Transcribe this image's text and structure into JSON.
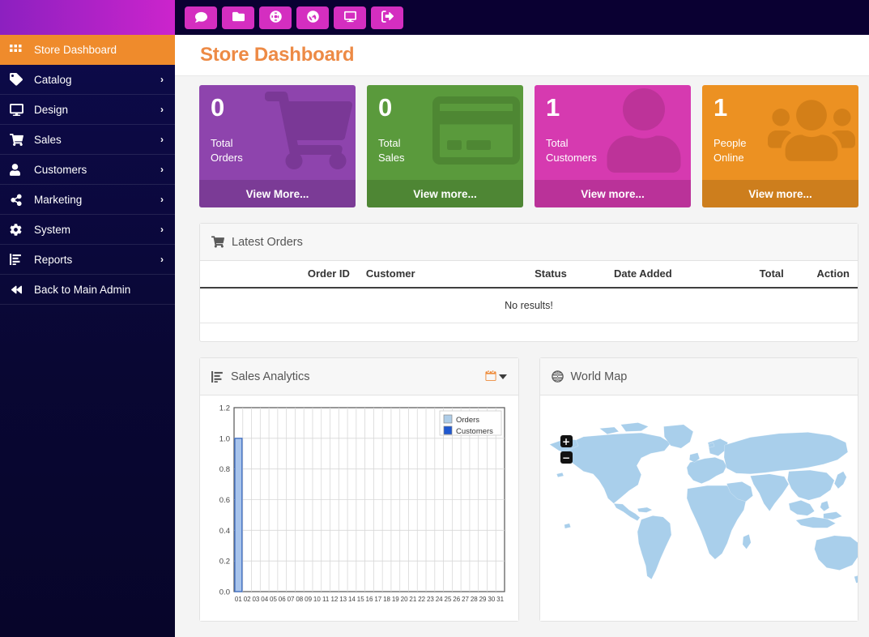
{
  "topbar": {
    "tools": [
      {
        "name": "comment-icon",
        "title": "Comments"
      },
      {
        "name": "folder-icon",
        "title": "Files"
      },
      {
        "name": "life-ring-icon",
        "title": "Support"
      },
      {
        "name": "globe-icon",
        "title": "Store Front"
      },
      {
        "name": "desktop-icon",
        "title": "Preview"
      },
      {
        "name": "sign-out-icon",
        "title": "Logout"
      }
    ],
    "accent_color": "#d42ec0",
    "background_color": "#0a0032",
    "logo_gradient_from": "#8c20c0",
    "logo_gradient_to": "#cc24cc"
  },
  "sidebar": {
    "background_color": "#0d0a4a",
    "active_color": "#ef8b2c",
    "items": [
      {
        "label": "Store Dashboard",
        "icon": "grid-icon",
        "active": true,
        "caret": ""
      },
      {
        "label": "Catalog",
        "icon": "tag-icon",
        "active": false,
        "caret": "›"
      },
      {
        "label": "Design",
        "icon": "desktop-icon",
        "active": false,
        "caret": "›"
      },
      {
        "label": "Sales",
        "icon": "cart-icon",
        "active": false,
        "caret": "›"
      },
      {
        "label": "Customers",
        "icon": "user-icon",
        "active": false,
        "caret": "›"
      },
      {
        "label": "Marketing",
        "icon": "share-icon",
        "active": false,
        "caret": "›"
      },
      {
        "label": "System",
        "icon": "gear-icon",
        "active": false,
        "caret": "›"
      },
      {
        "label": "Reports",
        "icon": "chart-bar-icon",
        "active": false,
        "caret": "›"
      },
      {
        "label": "Back to Main Admin",
        "icon": "backward-icon",
        "active": false,
        "caret": ""
      }
    ]
  },
  "page": {
    "title": "Store Dashboard",
    "title_color": "#ed8a45"
  },
  "tiles": [
    {
      "value": "0",
      "label": "Total\nOrders",
      "footer": "View More...",
      "icon": "shopping-cart-icon",
      "color": "#8e44ad"
    },
    {
      "value": "0",
      "label": "Total\nSales",
      "footer": "View more...",
      "icon": "credit-card-icon",
      "color": "#5a9a3c"
    },
    {
      "value": "1",
      "label": "Total\nCustomers",
      "footer": "View more...",
      "icon": "user-icon",
      "color": "#d63ab0"
    },
    {
      "value": "1",
      "label": "People\nOnline",
      "footer": "View more...",
      "icon": "users-icon",
      "color": "#ec9122"
    }
  ],
  "latest_orders": {
    "title": "Latest Orders",
    "icon": "shopping-cart-icon",
    "columns": [
      "Order ID",
      "Customer",
      "Status",
      "Date Added",
      "Total",
      "Action"
    ],
    "rows": [],
    "empty_text": "No results!"
  },
  "sales_analytics": {
    "title": "Sales Analytics",
    "icon": "chart-bar-icon",
    "calendar_icon": "calendar-icon",
    "caret_icon": "chevron-down-icon"
  },
  "world_map": {
    "title": "World Map",
    "icon": "globe-icon",
    "zoom_in_label": "+",
    "zoom_out_label": "−",
    "land_color": "#a9cfeb"
  },
  "chart_data": {
    "type": "bar",
    "title": "Sales Analytics",
    "xlabel": "",
    "ylabel": "",
    "ylim": [
      0.0,
      1.2
    ],
    "yticks": [
      "0.0",
      "0.2",
      "0.4",
      "0.6",
      "0.8",
      "1.0",
      "1.2"
    ],
    "categories": [
      "01",
      "02",
      "03",
      "04",
      "05",
      "06",
      "07",
      "08",
      "09",
      "10",
      "11",
      "12",
      "13",
      "14",
      "15",
      "16",
      "17",
      "18",
      "19",
      "20",
      "21",
      "22",
      "23",
      "24",
      "25",
      "26",
      "27",
      "28",
      "29",
      "30",
      "31"
    ],
    "series": [
      {
        "name": "Orders",
        "color": "#aecde8",
        "values": [
          0,
          0,
          0,
          0,
          0,
          0,
          0,
          0,
          0,
          0,
          0,
          0,
          0,
          0,
          0,
          0,
          0,
          0,
          0,
          0,
          0,
          0,
          0,
          0,
          0,
          0,
          0,
          0,
          0,
          0,
          0
        ]
      },
      {
        "name": "Customers",
        "color": "#1f58d0",
        "values": [
          1,
          0,
          0,
          0,
          0,
          0,
          0,
          0,
          0,
          0,
          0,
          0,
          0,
          0,
          0,
          0,
          0,
          0,
          0,
          0,
          0,
          0,
          0,
          0,
          0,
          0,
          0,
          0,
          0,
          0,
          0
        ]
      }
    ],
    "bar_fill": "#a8c4ec",
    "bar_stroke": "#4472c4",
    "grid": true,
    "legend_position": "top-right"
  }
}
